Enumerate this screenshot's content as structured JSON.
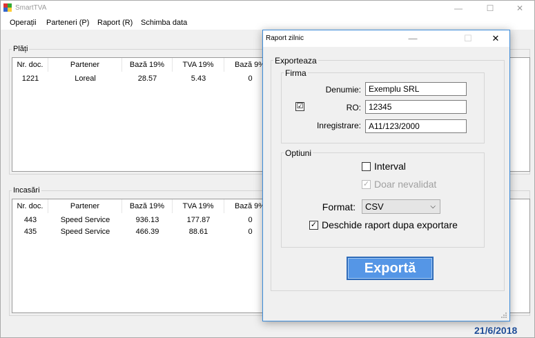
{
  "app": {
    "title": "SmartTVA"
  },
  "menu": [
    "Operații",
    "Parteneri (P)",
    "Raport (R)",
    "Schimba data"
  ],
  "plati": {
    "title": "Plăți",
    "columns": [
      "Nr. doc.",
      "Partener",
      "Bază 19%",
      "TVA 19%",
      "Bază 9%"
    ],
    "rows": [
      [
        "1221",
        "Loreal",
        "28.57",
        "5.43",
        "0"
      ]
    ]
  },
  "incasari": {
    "title": "Incasări",
    "columns": [
      "Nr. doc.",
      "Partener",
      "Bază 19%",
      "TVA 19%",
      "Bază 9%"
    ],
    "rows": [
      [
        "443",
        "Speed Service",
        "936.13",
        "177.87",
        "0"
      ],
      [
        "435",
        "Speed Service",
        "466.39",
        "88.61",
        "0"
      ]
    ]
  },
  "date": "21/6/2018",
  "dialog": {
    "title": "Raport zilnic",
    "export_group": "Exporteaza",
    "firma_group": "Firma",
    "denumie_label": "Denumie:",
    "denumie_value": "Exemplu SRL",
    "ro_label": "RO:",
    "ro_value": "12345",
    "ro_checked": "☑",
    "inregistrare_label": "Inregistrare:",
    "inregistrare_value": "A11/123/2000",
    "optiuni_group": "Optiuni",
    "interval_label": "Interval",
    "doar_label": "Doar nevalidat",
    "format_label": "Format:",
    "format_value": "CSV",
    "deschide_label": "Deschide raport dupa exportare",
    "export_button": "Exportă"
  }
}
